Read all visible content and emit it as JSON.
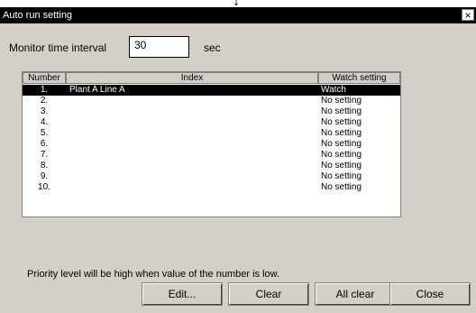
{
  "top_indicator": "↓",
  "window": {
    "title": "Auto run setting",
    "close_glyph": "×"
  },
  "monitor": {
    "label": "Monitor time interval",
    "value": "30",
    "unit": "sec"
  },
  "table": {
    "headers": [
      "Number",
      "Index",
      "Watch setting"
    ],
    "rows": [
      {
        "number": "1.",
        "index": "Plant A Line A",
        "watch": "Watch",
        "selected": true
      },
      {
        "number": "2.",
        "index": "",
        "watch": "No setting"
      },
      {
        "number": "3.",
        "index": "",
        "watch": "No setting"
      },
      {
        "number": "4.",
        "index": "",
        "watch": "No setting"
      },
      {
        "number": "5.",
        "index": "",
        "watch": "No setting"
      },
      {
        "number": "6.",
        "index": "",
        "watch": "No setting"
      },
      {
        "number": "7.",
        "index": "",
        "watch": "No setting"
      },
      {
        "number": "8.",
        "index": "",
        "watch": "No setting"
      },
      {
        "number": "9.",
        "index": "",
        "watch": "No setting"
      },
      {
        "number": "10.",
        "index": "",
        "watch": "No setting"
      }
    ]
  },
  "note": "Priority level will be high when value of the number is low.",
  "buttons": {
    "edit": "Edit...",
    "clear": "Clear",
    "all_clear": "All clear",
    "close": "Close"
  }
}
